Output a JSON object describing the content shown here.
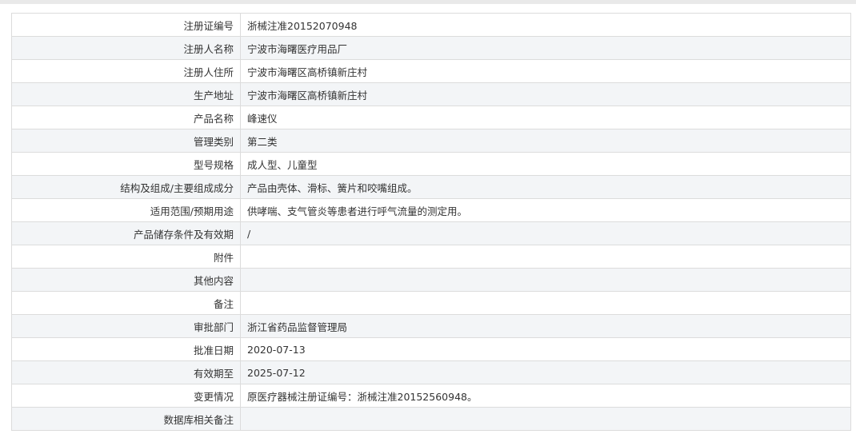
{
  "rows": [
    {
      "label": "注册证编号",
      "value": "浙械注准20152070948",
      "shade": false
    },
    {
      "label": "注册人名称",
      "value": "宁波市海曙医疗用品厂",
      "shade": true
    },
    {
      "label": "注册人住所",
      "value": "宁波市海曙区高桥镇新庄村",
      "shade": false
    },
    {
      "label": "生产地址",
      "value": "宁波市海曙区高桥镇新庄村",
      "shade": true
    },
    {
      "label": "产品名称",
      "value": "峰速仪",
      "shade": false
    },
    {
      "label": "管理类别",
      "value": "第二类",
      "shade": true
    },
    {
      "label": "型号规格",
      "value": "成人型、儿童型",
      "shade": false
    },
    {
      "label": "结构及组成/主要组成成分",
      "value": "产品由壳体、滑标、簧片和咬嘴组成。",
      "shade": true
    },
    {
      "label": "适用范围/预期用途",
      "value": "供哮喘、支气管炎等患者进行呼气流量的测定用。",
      "shade": false
    },
    {
      "label": "产品储存条件及有效期",
      "value": "/",
      "shade": true
    },
    {
      "label": "附件",
      "value": "",
      "shade": false
    },
    {
      "label": "其他内容",
      "value": "",
      "shade": true
    },
    {
      "label": "备注",
      "value": "",
      "shade": false
    },
    {
      "label": "审批部门",
      "value": "浙江省药品监督管理局",
      "shade": true
    },
    {
      "label": "批准日期",
      "value": "2020-07-13",
      "shade": false
    },
    {
      "label": "有效期至",
      "value": "2025-07-12",
      "shade": true
    },
    {
      "label": "变更情况",
      "value": "原医疗器械注册证编号：浙械注准20152560948。",
      "shade": false
    },
    {
      "label": "数据库相关备注",
      "value": "",
      "shade": true
    }
  ]
}
